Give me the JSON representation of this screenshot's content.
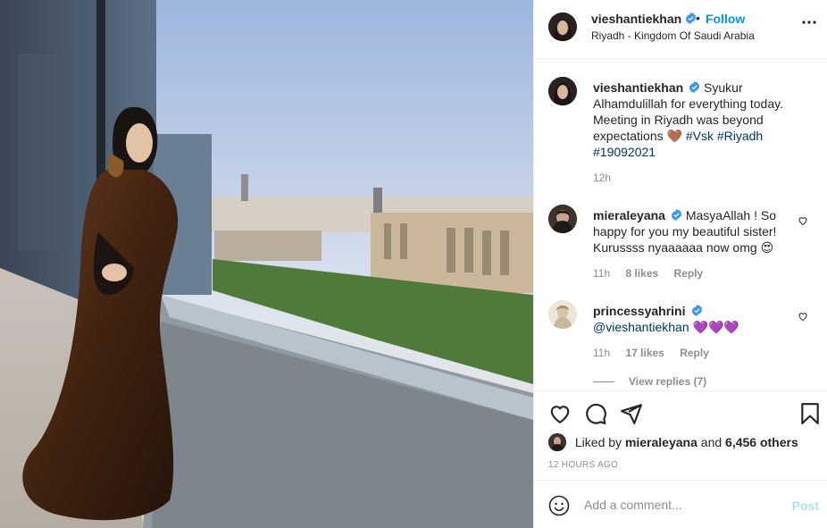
{
  "post": {
    "username": "vieshantiekhan",
    "follow_label": "Follow",
    "dot": "•",
    "location": "Riyadh - Kingdom Of Saudi Arabia",
    "photo_icon": "photo-of-woman-by-window"
  },
  "caption": {
    "username": "vieshantiekhan",
    "text": "Syukur Alhamdulillah for everything today. Meeting in Riyadh was beyond expectations",
    "emoji": "🤎",
    "hashtags": [
      "#Vsk",
      "#Riyadh",
      "#19092021"
    ],
    "time": "12h"
  },
  "comments": [
    {
      "username": "mieraleyana",
      "text": "MasyaAllah ! So happy for you my beautiful sister! Kurussss nyaaaaaa now omg",
      "emoji": "😍",
      "time": "11h",
      "likes": "8 likes",
      "reply_label": "Reply"
    },
    {
      "username": "princessyahrini",
      "mention": "@vieshantiekhan",
      "emoji": "💜💜💜",
      "time": "11h",
      "likes": "17 likes",
      "reply_label": "Reply"
    }
  ],
  "view_replies": "View replies (7)",
  "likes": {
    "prefix": "Liked by",
    "user": "mieraleyana",
    "and": "and",
    "others": "6,456 others"
  },
  "timestamp": "12 HOURS AGO",
  "add_comment": {
    "placeholder": "Add a comment...",
    "post_label": "Post"
  },
  "colors": {
    "accent": "#0095f6",
    "link": "#00376b",
    "muted": "#8e8e8e",
    "post_disabled": "#b2dffc"
  },
  "icons": [
    "more-icon",
    "verified-icon",
    "heart-icon",
    "comment-icon",
    "share-icon",
    "save-icon",
    "emoji-icon"
  ]
}
